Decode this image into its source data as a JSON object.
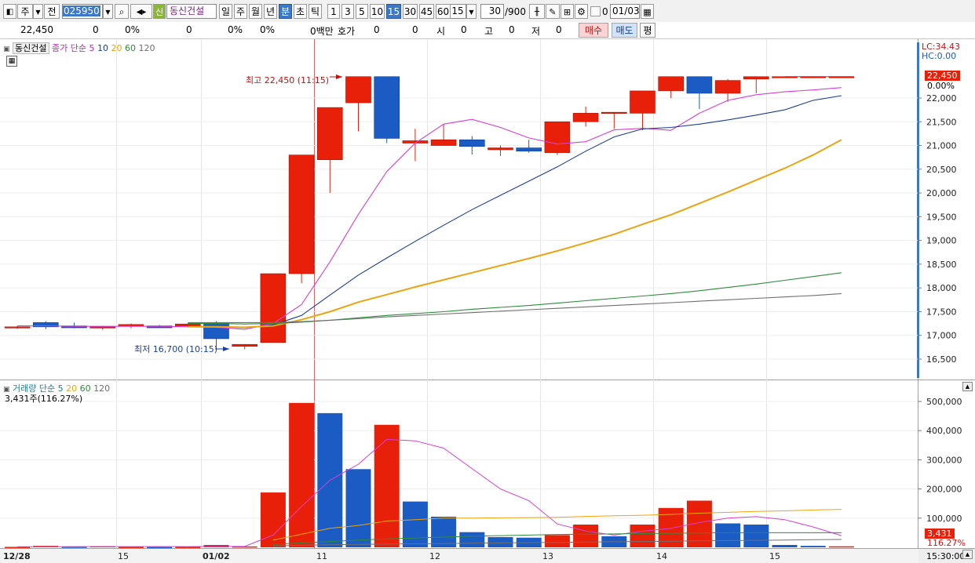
{
  "toolbar": {
    "type_label": "주",
    "prev_label": "전",
    "stock_code": "025950",
    "shin_badge": "신",
    "stock_name": "동신건설",
    "periods": [
      "일",
      "주",
      "월",
      "년",
      "분",
      "초",
      "틱"
    ],
    "selected_period": "분",
    "intervals": [
      "1",
      "3",
      "5",
      "10",
      "15",
      "30",
      "45",
      "60"
    ],
    "selected_interval": "15",
    "interval_value": "15",
    "count_value": "30",
    "count_max": "/900",
    "zero_label": "0",
    "date_value": "01/03"
  },
  "info_bar": {
    "price": "22,450",
    "change": "0",
    "change_pct": "0%",
    "f1": "0",
    "f1_pct": "0%",
    "f2_pct": "0%",
    "amount": "0백만",
    "hoga_label": "호가",
    "hoga_value": "0",
    "v2": "0",
    "open_label": "시",
    "open_value": "0",
    "high_label": "고",
    "high_value": "0",
    "low_label": "저",
    "low_value": "0",
    "buy_label": "매수",
    "sell_label": "매도",
    "avg_label": "평"
  },
  "price_panel": {
    "stock_name": "동신건설",
    "legend_prefix": "종가 단순 5",
    "ma_periods": [
      "10",
      "20",
      "60",
      "120"
    ],
    "lc_label": "LC:34.43",
    "hc_label": "HC:0.00",
    "current_price_label": "22,450",
    "current_pct_label": "0.00%",
    "high_annotation": "최고 22,450 (11:15)",
    "low_annotation": "최저 16,700 (10:15)"
  },
  "volume_panel": {
    "legend_prefix": "거래량 단순 5",
    "ma_periods": [
      "20",
      "60",
      "120"
    ],
    "current_volume_label": "3,431주(116.27%)",
    "current_volume": "3,431",
    "current_volume_pct": "116.27%"
  },
  "x_axis": {
    "labels": [
      "12/28",
      "15",
      "01/02",
      "11",
      "12",
      "13",
      "14",
      "15"
    ],
    "time_label": "15:30:00"
  },
  "chart_data": [
    {
      "type": "candlestick",
      "yticks": [
        16500,
        17000,
        17500,
        18000,
        18500,
        19000,
        19500,
        20000,
        20500,
        21000,
        21500,
        22000
      ],
      "ytick_labels": [
        "16,500",
        "17,000",
        "17,500",
        "18,000",
        "18,500",
        "19,000",
        "19,500",
        "20,000",
        "20,500",
        "21,000",
        "21,500",
        "22,000"
      ],
      "ylim": [
        16250,
        23100
      ],
      "colors": {
        "up": "#e8200a",
        "down": "#1a5bc4",
        "ma5": "#d63fd6",
        "ma10": "#1b3d8f",
        "ma20": "#e8a512",
        "ma60": "#2e8b3c",
        "ma120": "#6f6f6f"
      },
      "candles": [
        {
          "o": 17160,
          "h": 17200,
          "l": 17140,
          "c": 17180
        },
        {
          "o": 17270,
          "h": 17300,
          "l": 17130,
          "c": 17180
        },
        {
          "o": 17200,
          "h": 17270,
          "l": 17150,
          "c": 17160
        },
        {
          "o": 17160,
          "h": 17200,
          "l": 17120,
          "c": 17180
        },
        {
          "o": 17200,
          "h": 17250,
          "l": 17150,
          "c": 17230
        },
        {
          "o": 17200,
          "h": 17220,
          "l": 17160,
          "c": 17160
        },
        {
          "o": 17200,
          "h": 17250,
          "l": 17170,
          "c": 17240
        },
        {
          "o": 17270,
          "h": 17300,
          "l": 16700,
          "c": 16930
        },
        {
          "o": 16770,
          "h": 16820,
          "l": 16710,
          "c": 16810
        },
        {
          "o": 16850,
          "h": 18300,
          "l": 16850,
          "c": 18300
        },
        {
          "o": 18300,
          "h": 19500,
          "l": 18100,
          "c": 20800
        },
        {
          "o": 20700,
          "h": 21400,
          "l": 20000,
          "c": 21800
        },
        {
          "o": 21900,
          "h": 22450,
          "l": 21300,
          "c": 22450
        },
        {
          "o": 22450,
          "h": 22450,
          "l": 21050,
          "c": 21150
        },
        {
          "o": 21050,
          "h": 21350,
          "l": 20670,
          "c": 21100
        },
        {
          "o": 21000,
          "h": 21450,
          "l": 21000,
          "c": 21120
        },
        {
          "o": 21120,
          "h": 21200,
          "l": 20810,
          "c": 20980
        },
        {
          "o": 20910,
          "h": 21000,
          "l": 20780,
          "c": 20950
        },
        {
          "o": 20950,
          "h": 21120,
          "l": 20850,
          "c": 20880
        },
        {
          "o": 20850,
          "h": 21500,
          "l": 20800,
          "c": 21500
        },
        {
          "o": 21500,
          "h": 21820,
          "l": 21400,
          "c": 21680
        },
        {
          "o": 21680,
          "h": 21700,
          "l": 21350,
          "c": 21700
        },
        {
          "o": 21680,
          "h": 22150,
          "l": 21320,
          "c": 22150
        },
        {
          "o": 22150,
          "h": 22450,
          "l": 22000,
          "c": 22450
        },
        {
          "o": 22450,
          "h": 22450,
          "l": 21770,
          "c": 22100
        },
        {
          "o": 22100,
          "h": 22400,
          "l": 21920,
          "c": 22370
        },
        {
          "o": 22400,
          "h": 22450,
          "l": 22100,
          "c": 22450
        },
        {
          "o": 22450,
          "h": 22450,
          "l": 22450,
          "c": 22450
        },
        {
          "o": 22450,
          "h": 22450,
          "l": 22450,
          "c": 22450
        },
        {
          "o": 22450,
          "h": 22450,
          "l": 22450,
          "c": 22450
        }
      ],
      "ma_series": [
        {
          "key": "ma5",
          "values": [
            17200,
            17200,
            17190,
            17190,
            17190,
            17190,
            17180,
            17170,
            17130,
            17250,
            17650,
            18550,
            19550,
            20450,
            21050,
            21450,
            21550,
            21380,
            21160,
            21030,
            21080,
            21330,
            21360,
            21320,
            21680,
            21950,
            22070,
            22130,
            22170,
            22220
          ]
        },
        {
          "key": "ma10",
          "values": [
            null,
            null,
            null,
            null,
            null,
            null,
            17190,
            17180,
            17160,
            17220,
            17420,
            17850,
            18270,
            18630,
            18980,
            19320,
            19650,
            19950,
            20250,
            20550,
            20880,
            21180,
            21350,
            21380,
            21450,
            21540,
            21640,
            21750,
            21950,
            22050
          ]
        },
        {
          "key": "ma20",
          "values": [
            null,
            null,
            null,
            null,
            null,
            null,
            17180,
            17180,
            17170,
            17200,
            17330,
            17500,
            17700,
            17860,
            18020,
            18170,
            18320,
            18470,
            18620,
            18780,
            18950,
            19130,
            19340,
            19540,
            19780,
            20020,
            20270,
            20520,
            20800,
            21120,
            21450,
            21690
          ]
        },
        {
          "key": "ma60",
          "values": [
            null,
            null,
            null,
            null,
            null,
            null,
            17250,
            17250,
            17240,
            17250,
            17280,
            17320,
            17370,
            17420,
            17460,
            17500,
            17550,
            17590,
            17630,
            17680,
            17730,
            17780,
            17830,
            17880,
            17940,
            18010,
            18080,
            18160,
            18240,
            18320,
            18420,
            18520,
            18660
          ]
        },
        {
          "key": "ma120",
          "values": [
            null,
            null,
            null,
            null,
            null,
            null,
            17270,
            17270,
            17270,
            17270,
            17290,
            17320,
            17350,
            17390,
            17420,
            17450,
            17480,
            17510,
            17540,
            17570,
            17600,
            17630,
            17660,
            17690,
            17720,
            17750,
            17780,
            17810,
            17840,
            17880,
            17920,
            17960,
            18000
          ]
        }
      ]
    },
    {
      "type": "bar",
      "yticks": [
        100000,
        200000,
        300000,
        400000,
        500000
      ],
      "ytick_labels": [
        "100,000",
        "200,000",
        "300,000",
        "400,000",
        "500,000"
      ],
      "ylim": [
        0,
        520000
      ],
      "colors": {
        "up": "#e8200a",
        "down": "#1a5bc4",
        "ma5": "#d63fd6",
        "ma20": "#e8a512",
        "ma60": "#2e8b3c",
        "ma120": "#6f6f6f"
      },
      "bars": [
        {
          "v": 1500,
          "up": true
        },
        {
          "v": 5000,
          "up": true
        },
        {
          "v": 2000,
          "up": false
        },
        {
          "v": 4000,
          "up": true
        },
        {
          "v": 1500,
          "up": true
        },
        {
          "v": 1000,
          "up": false
        },
        {
          "v": 1500,
          "up": true
        },
        {
          "v": 8000,
          "up": true
        },
        {
          "v": 3000,
          "up": true
        },
        {
          "v": 188000,
          "up": true
        },
        {
          "v": 495000,
          "up": true
        },
        {
          "v": 460000,
          "up": false
        },
        {
          "v": 268000,
          "up": false
        },
        {
          "v": 420000,
          "up": true
        },
        {
          "v": 157000,
          "up": false
        },
        {
          "v": 105000,
          "up": false
        },
        {
          "v": 52000,
          "up": false
        },
        {
          "v": 35000,
          "up": false
        },
        {
          "v": 33000,
          "up": false
        },
        {
          "v": 42000,
          "up": true
        },
        {
          "v": 78000,
          "up": true
        },
        {
          "v": 38000,
          "up": false
        },
        {
          "v": 78000,
          "up": true
        },
        {
          "v": 135000,
          "up": true
        },
        {
          "v": 160000,
          "up": true
        },
        {
          "v": 82000,
          "up": false
        },
        {
          "v": 78000,
          "up": false
        },
        {
          "v": 8000,
          "up": false
        },
        {
          "v": 5000,
          "up": false
        },
        {
          "v": 3431,
          "up": true
        }
      ],
      "ma_series": [
        {
          "key": "ma5",
          "values": [
            2000,
            2000,
            2500,
            2500,
            2500,
            2700,
            2500,
            3000,
            3000,
            42000,
            140000,
            230000,
            285000,
            370000,
            365000,
            340000,
            270000,
            200000,
            160000,
            80000,
            56000,
            42000,
            55000,
            65000,
            85000,
            100000,
            105000,
            95000,
            70000,
            40000
          ]
        },
        {
          "key": "ma20",
          "values": [
            null,
            null,
            null,
            null,
            null,
            null,
            null,
            null,
            null,
            25000,
            45000,
            65000,
            75000,
            90000,
            95000,
            100000,
            100000,
            101000,
            102000,
            103000,
            106000,
            108000,
            110000,
            113000,
            117000,
            120000,
            123000,
            125000,
            128000,
            130000,
            133000
          ]
        },
        {
          "key": "ma60",
          "values": [
            null,
            null,
            null,
            null,
            null,
            null,
            null,
            null,
            null,
            10000,
            15000,
            20000,
            25000,
            29000,
            32000,
            35000,
            38000,
            40000,
            42000,
            44000,
            45000,
            46000,
            47000,
            48000,
            49000,
            50000,
            50000,
            50000,
            50000,
            50000,
            50000
          ]
        },
        {
          "key": "ma120",
          "values": [
            null,
            null,
            null,
            null,
            null,
            null,
            null,
            null,
            null,
            5000,
            7000,
            9000,
            10000,
            11000,
            12000,
            13000,
            14000,
            15000,
            16000,
            17000,
            18000,
            19000,
            20000,
            21000,
            22000,
            23000,
            24000,
            25000,
            26000,
            27000,
            28000
          ]
        }
      ]
    }
  ]
}
